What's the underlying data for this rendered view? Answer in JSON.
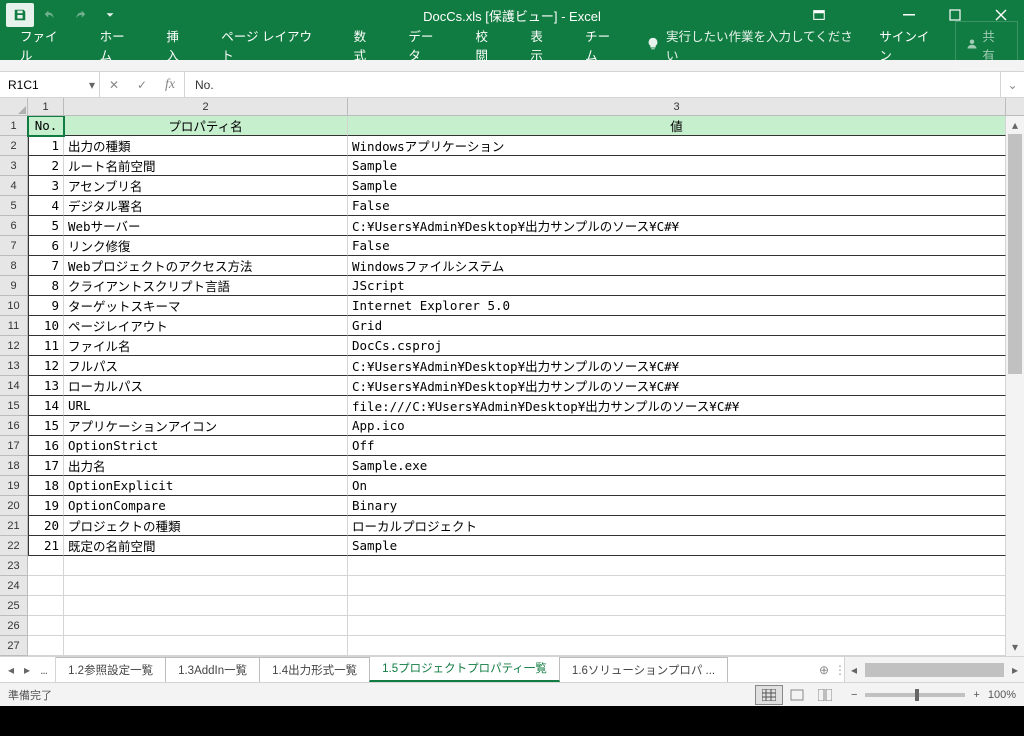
{
  "titlebar": {
    "title": "DocCs.xls  [保護ビュー] - Excel"
  },
  "ribbon": {
    "tabs": [
      "ファイル",
      "ホーム",
      "挿入",
      "ページ レイアウト",
      "数式",
      "データ",
      "校閲",
      "表示",
      "チーム"
    ],
    "tellme": "実行したい作業を入力してください",
    "signin": "サインイン",
    "share": "共有"
  },
  "namebox": "R1C1",
  "formula": "No.",
  "columns": {
    "c1": "1",
    "c2": "2",
    "c3": "3"
  },
  "header_row": {
    "no": "No.",
    "prop": "プロパティ名",
    "val": "値"
  },
  "rows": [
    {
      "no": "1",
      "prop": "出力の種類",
      "val": "Windowsアプリケーション"
    },
    {
      "no": "2",
      "prop": "ルート名前空間",
      "val": "Sample"
    },
    {
      "no": "3",
      "prop": "アセンブリ名",
      "val": "Sample"
    },
    {
      "no": "4",
      "prop": "デジタル署名",
      "val": "False"
    },
    {
      "no": "5",
      "prop": "Webサーバー",
      "val": "C:¥Users¥Admin¥Desktop¥出力サンプルのソース¥C#¥"
    },
    {
      "no": "6",
      "prop": "リンク修復",
      "val": "False"
    },
    {
      "no": "7",
      "prop": "Webプロジェクトのアクセス方法",
      "val": "Windowsファイルシステム"
    },
    {
      "no": "8",
      "prop": "クライアントスクリプト言語",
      "val": "JScript"
    },
    {
      "no": "9",
      "prop": "ターゲットスキーマ",
      "val": "Internet Explorer 5.0"
    },
    {
      "no": "10",
      "prop": "ページレイアウト",
      "val": "Grid"
    },
    {
      "no": "11",
      "prop": "ファイル名",
      "val": "DocCs.csproj"
    },
    {
      "no": "12",
      "prop": "フルパス",
      "val": "C:¥Users¥Admin¥Desktop¥出力サンプルのソース¥C#¥"
    },
    {
      "no": "13",
      "prop": "ローカルパス",
      "val": "C:¥Users¥Admin¥Desktop¥出力サンプルのソース¥C#¥"
    },
    {
      "no": "14",
      "prop": "URL",
      "val": "file:///C:¥Users¥Admin¥Desktop¥出力サンプルのソース¥C#¥"
    },
    {
      "no": "15",
      "prop": "アプリケーションアイコン",
      "val": "App.ico"
    },
    {
      "no": "16",
      "prop": "OptionStrict",
      "val": "Off"
    },
    {
      "no": "17",
      "prop": "出力名",
      "val": "Sample.exe"
    },
    {
      "no": "18",
      "prop": "OptionExplicit",
      "val": "On"
    },
    {
      "no": "19",
      "prop": "OptionCompare",
      "val": "Binary"
    },
    {
      "no": "20",
      "prop": "プロジェクトの種類",
      "val": "ローカルプロジェクト"
    },
    {
      "no": "21",
      "prop": "既定の名前空間",
      "val": "Sample"
    }
  ],
  "empty_rows": [
    23,
    24,
    25,
    26,
    27
  ],
  "sheettabs": {
    "prev_dots": "...",
    "tabs": [
      {
        "label": "1.2参照設定一覧",
        "active": false
      },
      {
        "label": "1.3AddIn一覧",
        "active": false
      },
      {
        "label": "1.4出力形式一覧",
        "active": false
      },
      {
        "label": "1.5プロジェクトプロパティ一覧",
        "active": true
      },
      {
        "label": "1.6ソリューションプロパ ...",
        "active": false
      }
    ]
  },
  "statusbar": {
    "ready": "準備完了",
    "zoom": "100%"
  }
}
